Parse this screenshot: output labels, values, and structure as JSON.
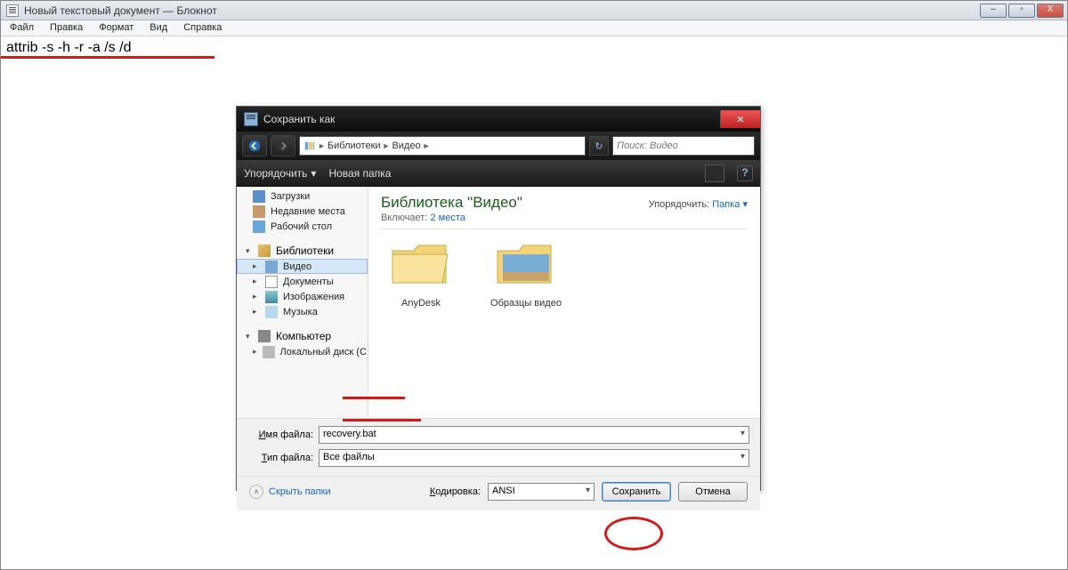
{
  "notepad": {
    "title": "Новый текстовый документ — Блокнот",
    "menu": {
      "file": "Файл",
      "edit": "Правка",
      "format": "Формат",
      "view": "Вид",
      "help": "Справка"
    },
    "content": "attrib -s -h -r -a /s /d",
    "winbtns": {
      "min": "–",
      "max": "▫",
      "close": "X"
    }
  },
  "dialog": {
    "title": "Сохранить как",
    "close_glyph": "✕",
    "breadcrumb": {
      "p1": "Библиотеки",
      "p2": "Видео",
      "sep": "►",
      "refresh": "↻"
    },
    "search_placeholder": "Поиск: Видео",
    "toolbar": {
      "organize": "Упорядочить",
      "caret": "▾",
      "newfolder": "Новая папка",
      "help": "?"
    },
    "side": {
      "downloads": "Загрузки",
      "recent": "Недавние места",
      "desktop": "Рабочий стол",
      "libraries": "Библиотеки",
      "video": "Видео",
      "documents": "Документы",
      "pictures": "Изображения",
      "music": "Музыка",
      "computer": "Компьютер",
      "localdisk": "Локальный диск (C:)",
      "tri_down": "▾",
      "tri_right": "▸"
    },
    "main": {
      "title": "Библиотека \"Видео\"",
      "includes_label": "Включает:",
      "includes_link": "2 места",
      "arrange_label": "Упорядочить:",
      "arrange_link": "Папка",
      "arrange_caret": "▾",
      "folders": [
        {
          "name": "AnyDesk"
        },
        {
          "name": "Образцы видео"
        }
      ]
    },
    "fields": {
      "filename_label": "Имя файла:",
      "filename_value": "recovery.bat",
      "filetype_label": "Тип файла:",
      "filetype_value": "Все файлы"
    },
    "bottom": {
      "hide": "Скрыть папки",
      "hide_caret": "˄",
      "encoding_label": "Кодировка:",
      "encoding_value": "ANSI",
      "encoding_caret": "▾",
      "save": "Сохранить",
      "cancel": "Отмена"
    }
  }
}
